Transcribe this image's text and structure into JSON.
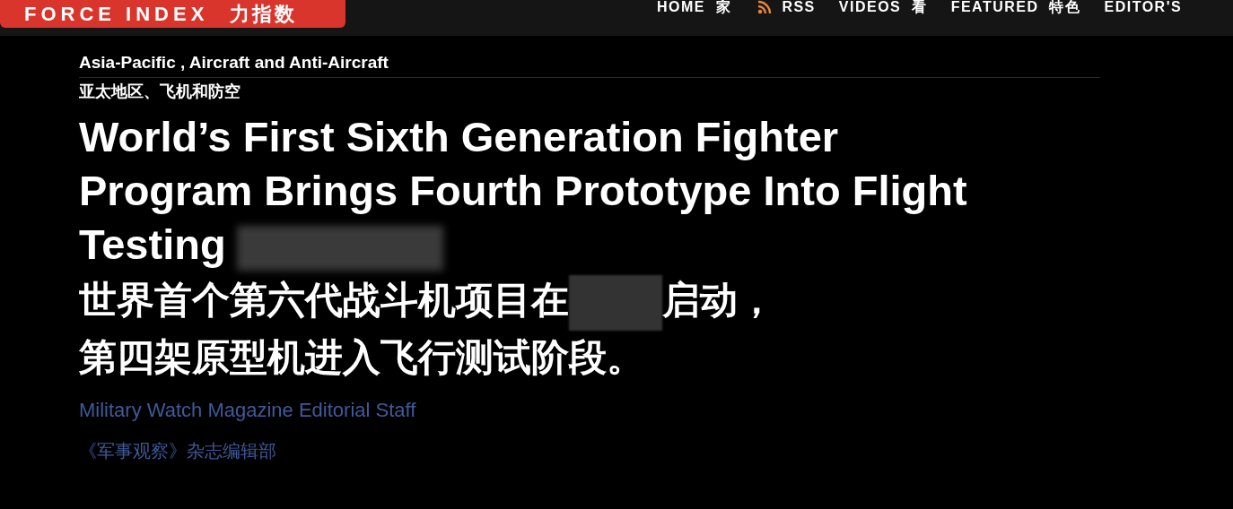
{
  "logo": {
    "text": "FORCE INDEX",
    "text_zh": "力指数"
  },
  "nav": [
    {
      "label": "HOME",
      "label_zh": "家",
      "kind": "link"
    },
    {
      "label": "RSS",
      "kind": "rss"
    },
    {
      "label": "VIDEOS",
      "label_zh": "看",
      "kind": "link"
    },
    {
      "label": "FEATURED",
      "label_zh": "特色",
      "kind": "link"
    },
    {
      "label": "EDITOR'S",
      "kind": "link"
    }
  ],
  "category": "Asia-Pacific , Aircraft and Anti-Aircraft",
  "category_zh": "亚太地区、飞机和防空",
  "headline": [
    "World’s First Sixth Generation Fighter",
    "Program Brings Fourth Prototype Into Flight",
    "Testing"
  ],
  "headline_zh": [
    {
      "text": "世界首个第六代战斗机项目在",
      "kind": "text"
    },
    {
      "kind": "redacted"
    },
    {
      "text": "启动，",
      "kind": "text"
    },
    {
      "kind": "break"
    },
    {
      "text": "第四架原型机进入飞行测试阶段。",
      "kind": "text"
    }
  ],
  "author": "Military Watch Magazine Editorial Staff",
  "author_zh": "《军事观察》杂志编辑部"
}
